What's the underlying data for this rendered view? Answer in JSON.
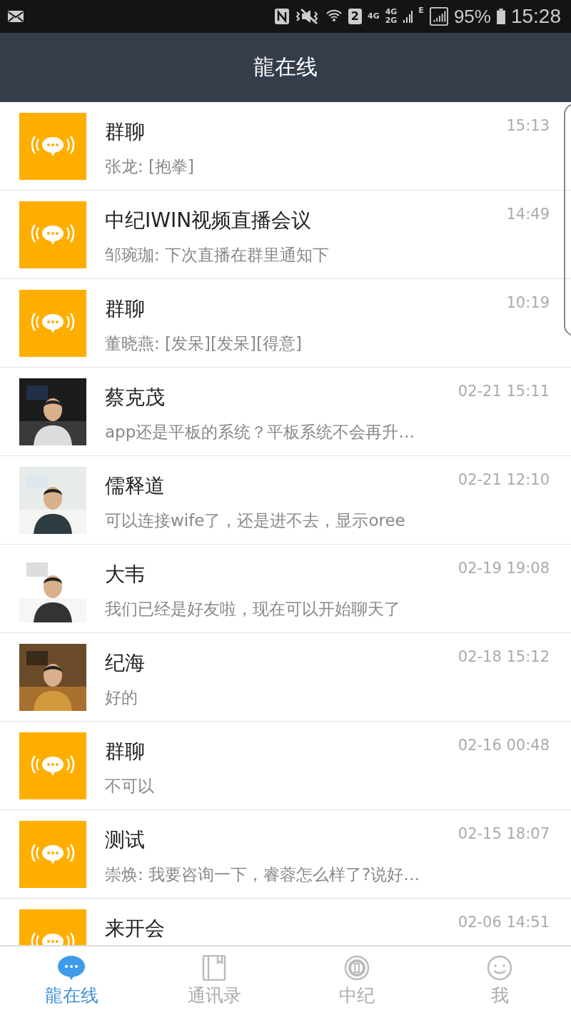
{
  "status_bar": {
    "sim_badge": "2",
    "network_top": "4G",
    "network_second": "4G",
    "network_third": "2G",
    "network_edge": "E",
    "battery": "95%",
    "time": "15:28"
  },
  "header": {
    "title": "龍在线"
  },
  "chats": [
    {
      "kind": "group",
      "name": "群聊",
      "preview": "张龙: [抱拳]",
      "time": "15:13"
    },
    {
      "kind": "group",
      "name": "中纪IWIN视频直播会议",
      "preview": "邹琬珈: 下次直播在群里通知下",
      "time": "14:49"
    },
    {
      "kind": "group",
      "name": "群聊",
      "preview": "董晓燕: [发呆][发呆][得意]",
      "time": "10:19"
    },
    {
      "kind": "picture",
      "name": "蔡克茂",
      "preview": "app还是平板的系统？平板系统不会再升…",
      "time": "02-21 15:11"
    },
    {
      "kind": "picture",
      "name": "儒释道",
      "preview": "可以连接wife了，还是进不去，显示oree",
      "time": "02-21 12:10"
    },
    {
      "kind": "picture",
      "name": "大韦",
      "preview": "我们已经是好友啦，现在可以开始聊天了",
      "time": "02-19 19:08"
    },
    {
      "kind": "picture",
      "name": "纪海",
      "preview": "好的",
      "time": "02-18 15:12"
    },
    {
      "kind": "group",
      "name": "群聊",
      "preview": "不可以",
      "time": "02-16 00:48"
    },
    {
      "kind": "group",
      "name": "测试",
      "preview": "崇焕: 我要咨询一下，睿蓉怎么样了?说好…",
      "time": "02-15 18:07"
    },
    {
      "kind": "group",
      "name": "来开会",
      "time": "02-06 14:51"
    }
  ],
  "tabs": [
    {
      "label": "龍在线",
      "selected": true
    },
    {
      "label": "通讯录",
      "selected": false
    },
    {
      "label": "中纪",
      "selected": false
    },
    {
      "label": "我",
      "selected": false
    }
  ]
}
